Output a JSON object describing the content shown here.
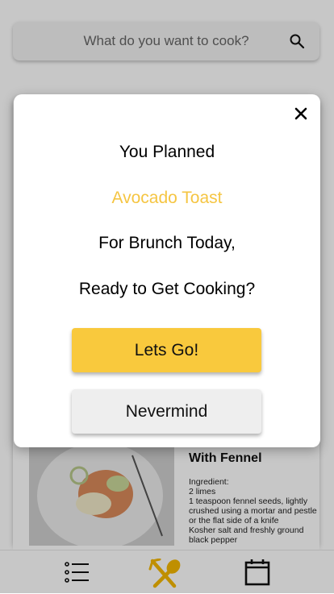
{
  "search": {
    "placeholder": "What do you want to cook?"
  },
  "recipe": {
    "title": "With Fennel",
    "ingredients_label": "Ingredient:",
    "ingredients": [
      "2  limes",
      "1  teaspoon fennel seeds, lightly crushed using a mortar and pestle or the flat side of a knife",
      " Kosher salt and freshly ground black pepper"
    ]
  },
  "modal": {
    "line1": "You Planned",
    "recipe_name": "Avocado Toast",
    "line3": "For Brunch Today,",
    "line4": "Ready to Get Cooking?",
    "confirm_label": "Lets Go!",
    "cancel_label": "Nevermind"
  },
  "colors": {
    "accent_yellow": "#f9c93d",
    "recipe_name_color": "#f5c542"
  },
  "nav": {
    "items": [
      {
        "icon": "list-icon"
      },
      {
        "icon": "fork-spoon-icon",
        "active": true
      },
      {
        "icon": "calendar-icon"
      }
    ]
  }
}
